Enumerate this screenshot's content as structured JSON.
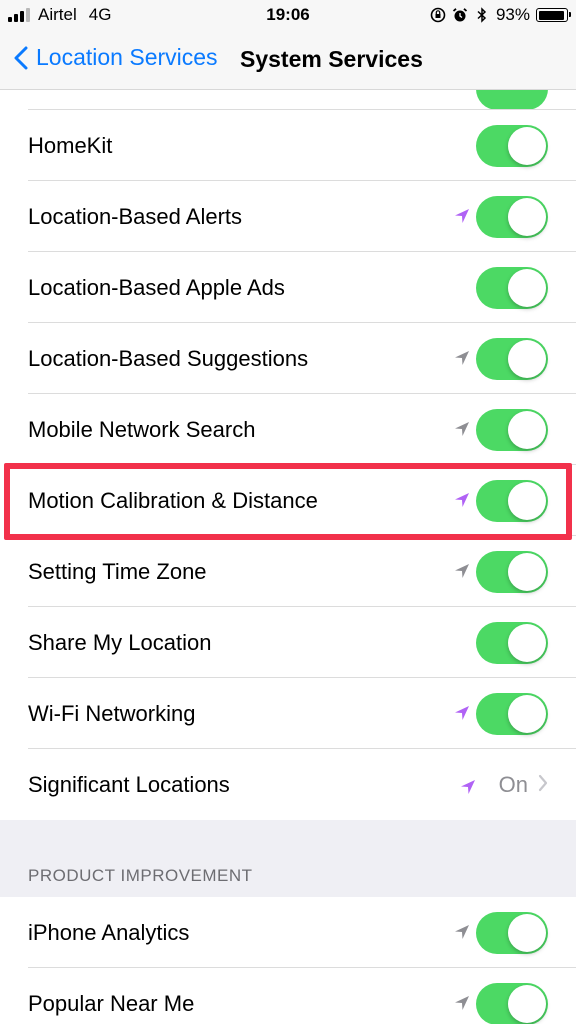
{
  "status_bar": {
    "carrier": "Airtel",
    "network": "4G",
    "time": "19:06",
    "battery_percent": "93%",
    "battery_level": 0.93,
    "icons": [
      "signal-icon",
      "orientation-lock-icon",
      "alarm-icon",
      "bluetooth-icon",
      "battery-icon"
    ]
  },
  "nav": {
    "back_label": "Location Services",
    "title": "System Services"
  },
  "colors": {
    "accent": "#0a7aff",
    "toggle_on": "#4cd964",
    "location_purple": "#b062f5",
    "location_gray": "#8e8e93",
    "highlight": "#f2314b"
  },
  "services": [
    {
      "label": "HomeKit",
      "indicator": "none",
      "on": true
    },
    {
      "label": "Location-Based Alerts",
      "indicator": "purple",
      "on": true
    },
    {
      "label": "Location-Based Apple Ads",
      "indicator": "none",
      "on": true
    },
    {
      "label": "Location-Based Suggestions",
      "indicator": "gray",
      "on": true
    },
    {
      "label": "Mobile Network Search",
      "indicator": "gray",
      "on": true
    },
    {
      "label": "Motion Calibration & Distance",
      "indicator": "purple",
      "on": true,
      "highlighted": true
    },
    {
      "label": "Setting Time Zone",
      "indicator": "gray",
      "on": true
    },
    {
      "label": "Share My Location",
      "indicator": "none",
      "on": true
    },
    {
      "label": "Wi-Fi Networking",
      "indicator": "purple",
      "on": true
    },
    {
      "label": "Significant Locations",
      "indicator": "purple",
      "value": "On"
    }
  ],
  "product_improvement": {
    "header": "PRODUCT IMPROVEMENT",
    "items": [
      {
        "label": "iPhone Analytics",
        "indicator": "gray",
        "on": true
      },
      {
        "label": "Popular Near Me",
        "indicator": "gray",
        "on": true
      }
    ]
  }
}
